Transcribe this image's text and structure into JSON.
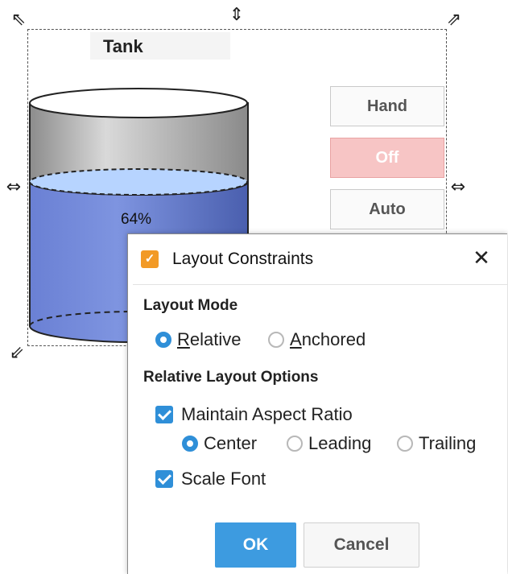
{
  "component": {
    "title": "Tank",
    "fill_percent_label": "64%",
    "level": 0.64,
    "buttons": {
      "hand": "Hand",
      "off": "Off",
      "auto": "Auto"
    }
  },
  "dialog": {
    "title": "Layout Constraints",
    "close_glyph": "✕",
    "layout_mode_label": "Layout Mode",
    "mode_relative_first": "R",
    "mode_relative_rest": "elative",
    "mode_anchored_first": "A",
    "mode_anchored_rest": "nchored",
    "relative_options_label": "Relative Layout Options",
    "maintain_aspect_label": "Maintain Aspect Ratio",
    "align_center": "Center",
    "align_leading": "Leading",
    "align_trailing": "Trailing",
    "scale_font_label": "Scale Font",
    "ok_label": "OK",
    "cancel_label": "Cancel"
  },
  "colors": {
    "accent": "#2f8fd8",
    "liquid": "#6f85d6",
    "off_button": "#f7c5c5"
  },
  "icons": {
    "resize_nw_se": "resize-diagonal-icon",
    "resize_ns": "resize-vertical-icon",
    "resize_ew": "resize-horizontal-icon",
    "app": "layout-app-icon",
    "close": "close-icon"
  }
}
